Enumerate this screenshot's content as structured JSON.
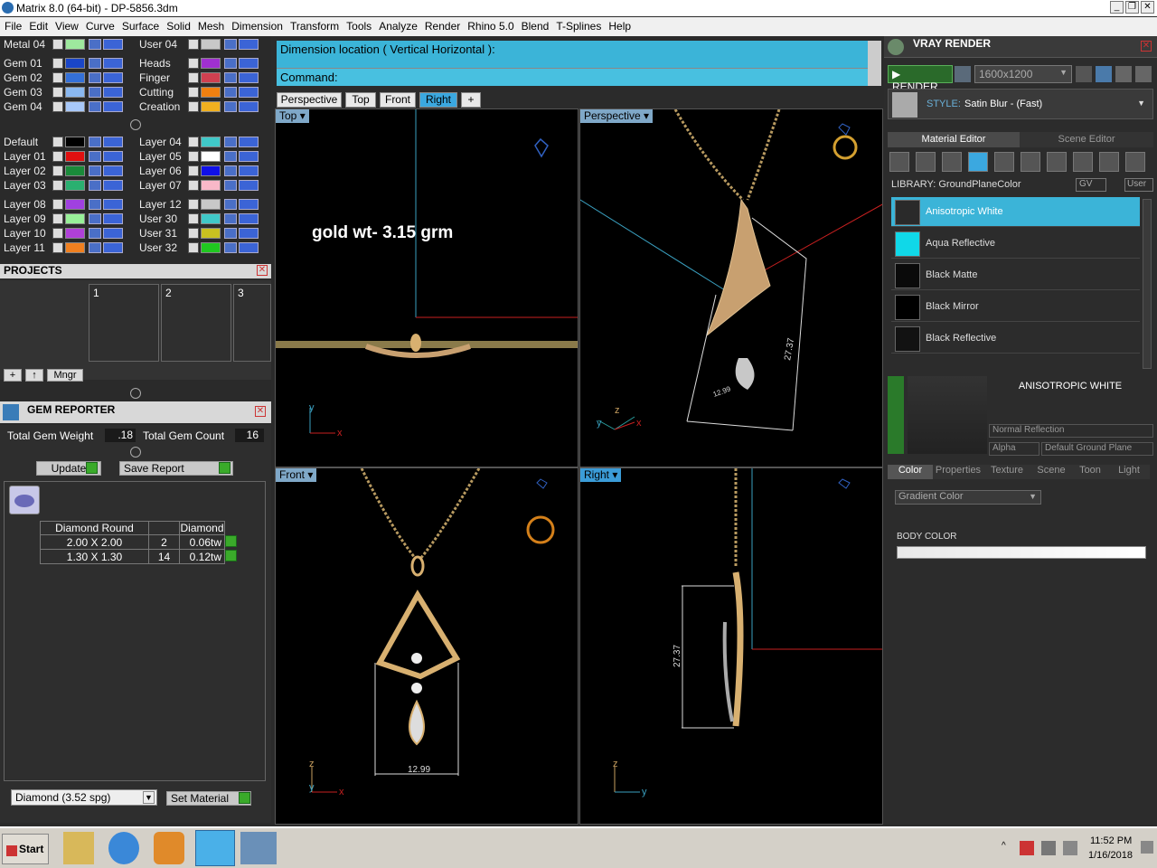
{
  "window": {
    "title": "Matrix 8.0 (64-bit) - DP-5856.3dm",
    "controls": [
      "_",
      "❐",
      "✕"
    ]
  },
  "menu": [
    "File",
    "Edit",
    "View",
    "Curve",
    "Surface",
    "Solid",
    "Mesh",
    "Dimension",
    "Transform",
    "Tools",
    "Analyze",
    "Render",
    "Rhino 5.0",
    "Blend",
    "T-Splines",
    "Help"
  ],
  "layers_left": [
    {
      "name": "Metal 04",
      "color": "#9ee89e"
    },
    {
      "name": "Gem 01",
      "color": "#1a46c8"
    },
    {
      "name": "Gem 02",
      "color": "#3470d8"
    },
    {
      "name": "Gem 03",
      "color": "#8ab8f0"
    },
    {
      "name": "Gem 04",
      "color": "#a8c8f8"
    },
    {
      "name": "Default",
      "color": "#000000"
    },
    {
      "name": "Layer 01",
      "color": "#e01010"
    },
    {
      "name": "Layer 02",
      "color": "#1a8a3a"
    },
    {
      "name": "Layer 03",
      "color": "#2ab070"
    },
    {
      "name": "Layer 08",
      "color": "#a040e0"
    },
    {
      "name": "Layer 09",
      "color": "#98f098"
    },
    {
      "name": "Layer 10",
      "color": "#b040d8"
    },
    {
      "name": "Layer 11",
      "color": "#f08020"
    }
  ],
  "layers_right": [
    {
      "name": "User 04",
      "color": "#c8c8c8"
    },
    {
      "name": "Heads",
      "color": "#a030d0"
    },
    {
      "name": "Finger",
      "color": "#d04050"
    },
    {
      "name": "Cutting",
      "color": "#f08010"
    },
    {
      "name": "Creation",
      "color": "#f0b020"
    },
    {
      "name": "Layer 04",
      "color": "#40c8c8"
    },
    {
      "name": "Layer 05",
      "color": "#ffffff"
    },
    {
      "name": "Layer 06",
      "color": "#1010e8"
    },
    {
      "name": "Layer 07",
      "color": "#f8b8c8"
    },
    {
      "name": "Layer 12",
      "color": "#c8c8c8"
    },
    {
      "name": "User 30",
      "color": "#40c8c8"
    },
    {
      "name": "User 31",
      "color": "#c8c020"
    },
    {
      "name": "User 32",
      "color": "#20c820"
    }
  ],
  "projects": {
    "title": "PROJECTS",
    "slots": [
      "1",
      "2",
      "3"
    ],
    "mngr_label": "Mngr"
  },
  "gem_reporter": {
    "title": "GEM REPORTER",
    "total_weight_label": "Total Gem Weight",
    "total_weight_value": ".18",
    "total_count_label": "Total Gem Count",
    "total_count_value": "16",
    "update_label": "Update",
    "save_label": "Save Report",
    "table_headers": [
      "Diamond Round",
      "",
      "Diamond"
    ],
    "rows": [
      {
        "size": "2.00 X 2.00",
        "count": "2",
        "weight": "0.06tw"
      },
      {
        "size": "1.30 X 1.30",
        "count": "14",
        "weight": "0.12tw"
      }
    ],
    "material_select": "Diamond    (3.52 spg)",
    "set_material_label": "Set Material"
  },
  "command": {
    "prompt_line": "Dimension location ( Vertical  Horizontal ):",
    "command_label": "Command:"
  },
  "view_tabs": [
    "Perspective",
    "Top",
    "Front",
    "Right"
  ],
  "viewports": {
    "top": {
      "label": "Top",
      "annotation": "gold wt- 3.15 grm"
    },
    "perspective": {
      "label": "Perspective",
      "dim1": "27.37",
      "dim2": "12.99"
    },
    "front": {
      "label": "Front",
      "dim": "12.99"
    },
    "right": {
      "label": "Right",
      "dim": "27.37"
    }
  },
  "vray": {
    "title": "VRAY RENDER",
    "render_label": "RENDER",
    "resolution": "1600x1200",
    "style_label": "STYLE:",
    "style_value": "Satin Blur - (Fast)",
    "tabs": [
      "Material Editor",
      "Scene Editor"
    ],
    "library_label": "LIBRARY: GroundPlaneColor",
    "gv_label": "GV",
    "user_label": "User",
    "materials": [
      {
        "name": "Anisotropic White",
        "color": "#2a2a2a",
        "selected": true
      },
      {
        "name": "Aqua Reflective",
        "color": "#10d8e8",
        "selected": false
      },
      {
        "name": "Black Matte",
        "color": "#0a0a0a",
        "selected": false
      },
      {
        "name": "Black Mirror",
        "color": "#000000",
        "selected": false
      },
      {
        "name": "Black Reflective",
        "color": "#121212",
        "selected": false
      }
    ],
    "preview_title": "ANISOTROPIC WHITE",
    "reflection_mode": "Normal Reflection",
    "alpha_label": "Alpha",
    "ground_plane": "Default Ground Plane",
    "prop_tabs": [
      "Color",
      "Properties",
      "Texture",
      "Scene",
      "Toon",
      "Light"
    ],
    "color_mode": "Gradient Color",
    "body_color_label": "BODY COLOR"
  },
  "taskbar": {
    "start_label": "Start",
    "time": "11:52 PM",
    "date": "1/16/2018"
  }
}
